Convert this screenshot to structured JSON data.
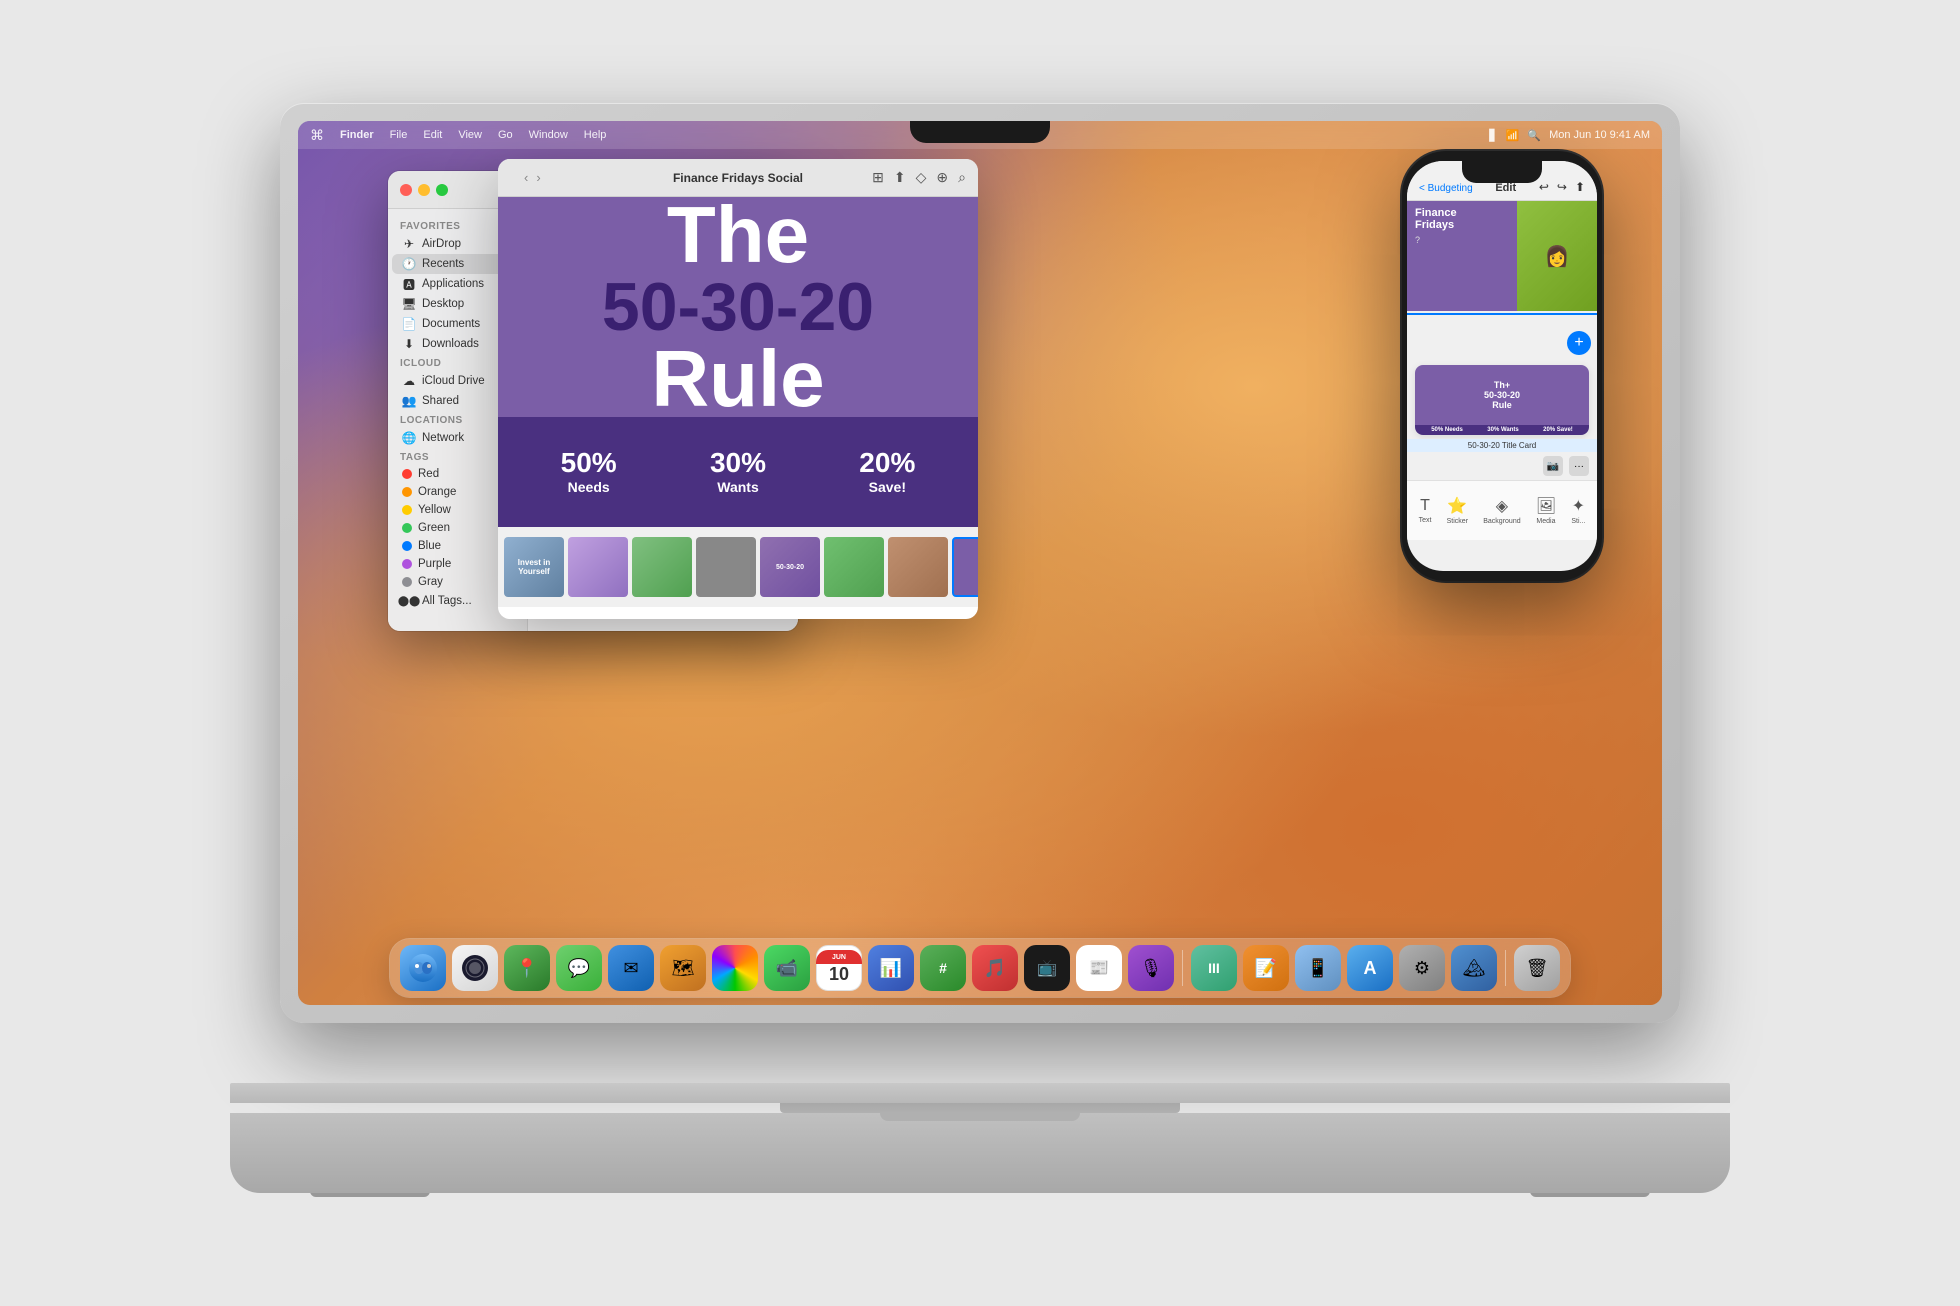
{
  "laptop": {
    "screen_title": "Finder"
  },
  "menubar": {
    "apple": "⌘",
    "items": [
      "Finder",
      "File",
      "Edit",
      "View",
      "Go",
      "Window",
      "Help"
    ],
    "time": "Mon Jun 10  9:41 AM",
    "battery": "🔋",
    "wifi": "WiFi",
    "search": "🔍"
  },
  "finder": {
    "title": "Finance Fridays Social",
    "sidebar": {
      "favorites_label": "Favorites",
      "icloud_label": "iCloud",
      "locations_label": "Locations",
      "tags_label": "Tags",
      "items": [
        {
          "label": "AirDrop",
          "icon": "✈"
        },
        {
          "label": "Recents",
          "icon": "🕐"
        },
        {
          "label": "Applications",
          "icon": "🅰"
        },
        {
          "label": "Desktop",
          "icon": "🖥"
        },
        {
          "label": "Documents",
          "icon": "📄"
        },
        {
          "label": "Downloads",
          "icon": "⬇"
        },
        {
          "label": "iCloud Drive",
          "icon": "☁"
        },
        {
          "label": "Shared",
          "icon": "👥"
        },
        {
          "label": "Network",
          "icon": "🌐"
        },
        {
          "label": "Red",
          "color": "#FF3B30"
        },
        {
          "label": "Orange",
          "color": "#FF9500"
        },
        {
          "label": "Yellow",
          "color": "#FFCC00"
        },
        {
          "label": "Green",
          "color": "#34C759"
        },
        {
          "label": "Blue",
          "color": "#007AFF"
        },
        {
          "label": "Purple",
          "color": "#AF52DE"
        },
        {
          "label": "Gray",
          "color": "#8E8E93"
        },
        {
          "label": "All Tags...",
          "color": null
        }
      ]
    }
  },
  "design_card": {
    "title": "Finance Fridays Social",
    "headline_the": "The",
    "headline_numbers": "50-30-20",
    "headline_rule": "Rule",
    "stats": [
      {
        "pct": "50%",
        "label": "Needs"
      },
      {
        "pct": "30%",
        "label": "Wants"
      },
      {
        "pct": "20%",
        "label": "Save!"
      }
    ]
  },
  "iphone": {
    "top_bar_back": "< Budgeting",
    "top_bar_title": "Edit",
    "card_label": "50-30-20 Title Card",
    "toolbar_items": [
      "Text",
      "Sticker",
      "Background",
      "Media",
      "Sti..."
    ]
  },
  "dock": {
    "items": [
      {
        "label": "Finder",
        "emoji": "🔵"
      },
      {
        "label": "Launchpad",
        "emoji": "🚀"
      },
      {
        "label": "Maps",
        "emoji": "📍"
      },
      {
        "label": "Messages",
        "emoji": "💬"
      },
      {
        "label": "Mail",
        "emoji": "✉"
      },
      {
        "label": "Maps2",
        "emoji": "🗺"
      },
      {
        "label": "Photos",
        "emoji": "🌈"
      },
      {
        "label": "FaceTime",
        "emoji": "📹"
      },
      {
        "label": "Calendar",
        "emoji": "📅"
      },
      {
        "label": "Keynote",
        "emoji": "📊"
      },
      {
        "label": "Numbers",
        "emoji": "#"
      },
      {
        "label": "Music",
        "emoji": "🎵"
      },
      {
        "label": "TV",
        "emoji": "📺"
      },
      {
        "label": "News",
        "emoji": "📰"
      },
      {
        "label": "Podcasts",
        "emoji": "🎙"
      },
      {
        "label": "Pages",
        "emoji": "📝"
      },
      {
        "label": "Freeform",
        "emoji": "✏"
      },
      {
        "label": "iPhone",
        "emoji": "📱"
      },
      {
        "label": "App Store",
        "emoji": "A"
      },
      {
        "label": "Settings",
        "emoji": "⚙"
      },
      {
        "label": "Sequoia",
        "emoji": "🏔"
      },
      {
        "label": "Trash",
        "emoji": "🗑"
      }
    ]
  }
}
